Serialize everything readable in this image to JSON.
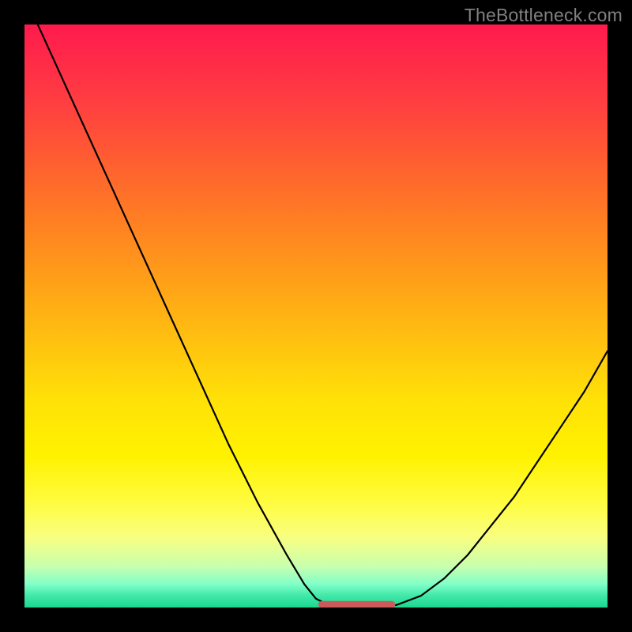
{
  "watermark": "TheBottleneck.com",
  "chart_data": {
    "type": "line",
    "title": "",
    "xlabel": "",
    "ylabel": "",
    "xlim": [
      0,
      100
    ],
    "ylim": [
      0,
      100
    ],
    "series": [
      {
        "name": "bottleneck-curve",
        "x": [
          0,
          5,
          10,
          15,
          20,
          25,
          30,
          35,
          40,
          45,
          48,
          50,
          52,
          54,
          56,
          58,
          60,
          62,
          64,
          68,
          72,
          76,
          80,
          84,
          88,
          92,
          96,
          100
        ],
        "y": [
          105,
          94,
          83,
          72,
          61,
          50,
          39,
          28,
          18,
          9,
          4,
          1.5,
          0.5,
          0,
          0,
          0,
          0,
          0,
          0.5,
          2,
          5,
          9,
          14,
          19,
          25,
          31,
          37,
          44
        ]
      }
    ],
    "flat_region": {
      "x_start": 51,
      "x_end": 63,
      "y": 0.5
    },
    "background_gradient": {
      "top": "#ff1a4d",
      "mid": "#ffe008",
      "bottom": "#1ad890"
    }
  }
}
